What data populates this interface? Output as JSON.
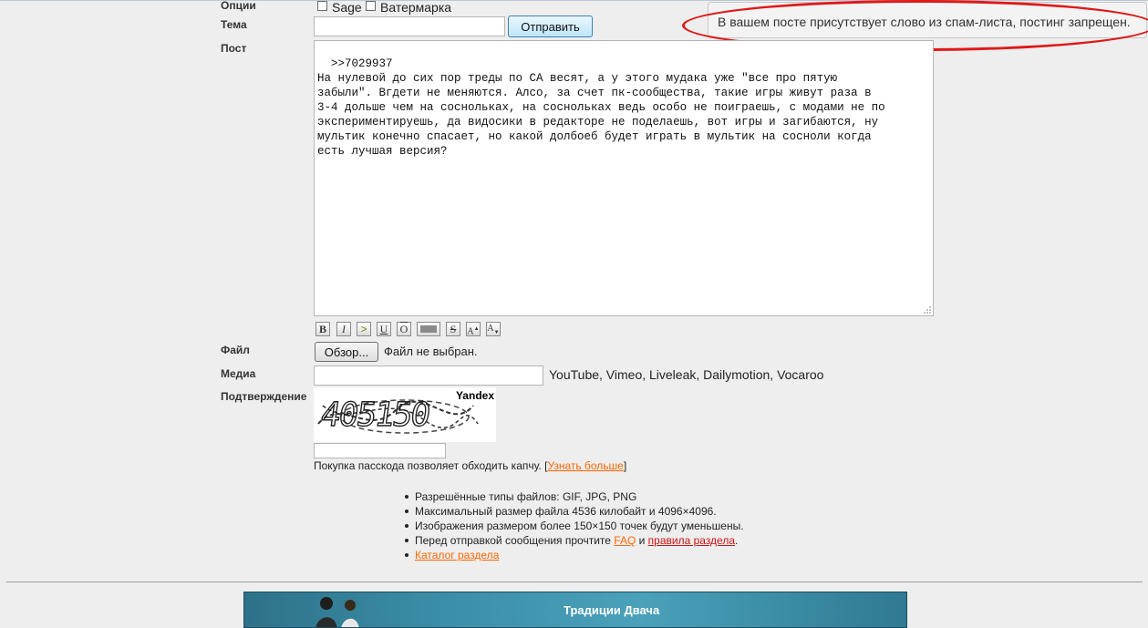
{
  "form": {
    "options_label": "Опции",
    "sage_label": "Sage",
    "watermark_label": "Ватермарка",
    "subject_label": "Тема",
    "subject_value": "",
    "submit_label": "Отправить",
    "post_label": "Пост",
    "post_text": ">>7029937\nНа нулевой до сих пор треды по СА весят, а у этого мудака уже \"все про пятую\nзабыли\". Вгдети не меняются. Алсо, за счет пк-сообщества, такие игры живут раза в\n3-4 дольше чем на соснольках, на соснольках ведь особо не поиграешь, с модами не по\nэкспериментируешь, да видосики в редакторе не поделаешь, вот игры и загибаются, ну\nмультик конечно спасает, но какой долбоеб будет играть в мультик на сосноли когда\nесть лучшая версия?",
    "format_buttons": [
      "B",
      "I",
      ">",
      "U",
      "O",
      "",
      "S",
      "A",
      "A"
    ],
    "file_label": "Файл",
    "browse_label": "Обзор...",
    "file_status": "Файл не выбран.",
    "media_label": "Медиа",
    "media_value": "",
    "media_hint": "YouTube, Vimeo, Liveleak, Dailymotion, Vocaroo",
    "captcha_label": "Подтверждение",
    "captcha_text": "405150",
    "captcha_brand": "Yandex",
    "captcha_value": "",
    "passcode_text": "Покупка пасскода позволяет обходить капчу. [",
    "passcode_link": "Узнать больше",
    "passcode_close": "]"
  },
  "notice": {
    "spam_message": "В вашем посте присутствует слово из спам-листа, постинг запрещен."
  },
  "rules": {
    "item1": "Разрешённые типы файлов: GIF, JPG, PNG",
    "item2": "Максимальный размер файла 4536 килобайт и 4096×4096.",
    "item3": "Изображения размером более 150×150 точек будут уменьшены.",
    "item4_prefix": "Перед отправкой сообщения прочтите ",
    "faq_link": "FAQ",
    "item4_mid": " и ",
    "rules_link": "правила раздела",
    "item4_suffix": ".",
    "catalog_link": "Каталог раздела"
  },
  "banner": {
    "title": "Традиции Двача"
  },
  "colors": {
    "background": "#eeeeee",
    "link_orange": "#ff6600",
    "link_red": "#cc1111",
    "highlight_ellipse": "#e01818"
  }
}
